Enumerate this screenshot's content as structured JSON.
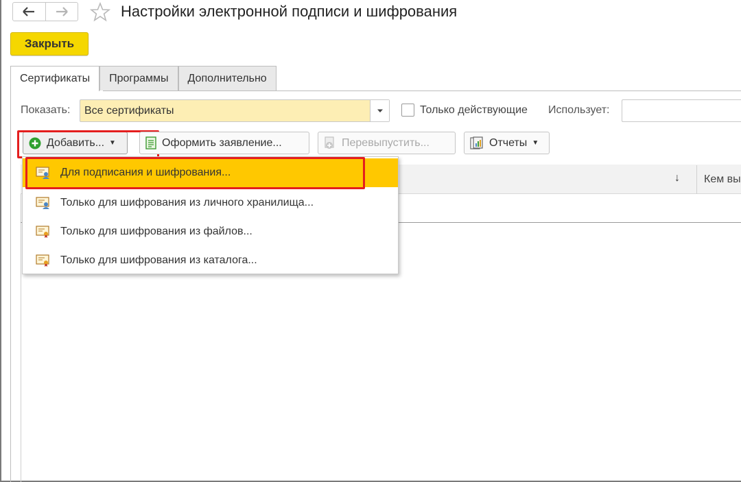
{
  "window": {
    "title": "Настройки электронной подписи и шифрования"
  },
  "toolbar": {
    "close_label": "Закрыть"
  },
  "tabs": [
    {
      "label": "Сертификаты",
      "active": true
    },
    {
      "label": "Программы",
      "active": false
    },
    {
      "label": "Дополнительно",
      "active": false
    }
  ],
  "filter": {
    "show_label": "Показать:",
    "show_value": "Все сертификаты",
    "only_active_label": "Только действующие",
    "only_active_checked": false,
    "uses_label": "Использует:",
    "uses_value": ""
  },
  "commands": {
    "add_label": "Добавить...",
    "application_label": "Оформить заявление...",
    "reissue_label": "Перевыпустить...",
    "reports_label": "Отчеты"
  },
  "table": {
    "sort_indicator": "↓",
    "column_issued_by": "Кем вы"
  },
  "add_menu": {
    "items": [
      {
        "label": "Для подписания и шифрования...",
        "selected": true,
        "icon": "certificate-person-icon"
      },
      {
        "label": "Только для шифрования из личного хранилища...",
        "selected": false,
        "icon": "certificate-person-icon"
      },
      {
        "label": "Только для шифрования из файлов...",
        "selected": false,
        "icon": "certificate-icon"
      },
      {
        "label": "Только для шифрования из каталога...",
        "selected": false,
        "icon": "certificate-icon"
      }
    ]
  },
  "colors": {
    "accent_yellow": "#f5d700",
    "selection": "#ffc800",
    "highlight_red": "#e41e1e",
    "field_fill": "#fdeeb4"
  }
}
